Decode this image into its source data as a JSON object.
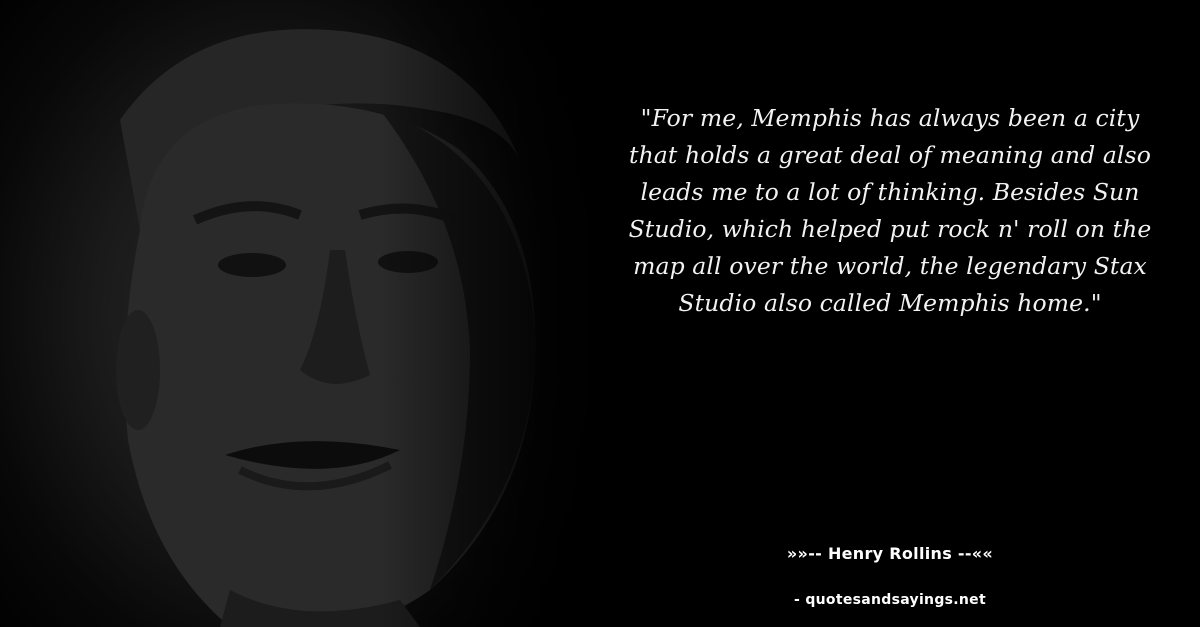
{
  "quote": {
    "text": "\"For me, Memphis has always been a city that holds a great deal of meaning and also leads me to a lot of thinking. Besides Sun Studio, which helped put rock n' roll on the map all over the world, the legendary Stax Studio also called Memphis home.\""
  },
  "author": {
    "line": "»»-- Henry Rollins --««"
  },
  "source": {
    "line": "- quotesandsayings.net"
  },
  "colors": {
    "background": "#000000",
    "text": "#ffffff"
  }
}
